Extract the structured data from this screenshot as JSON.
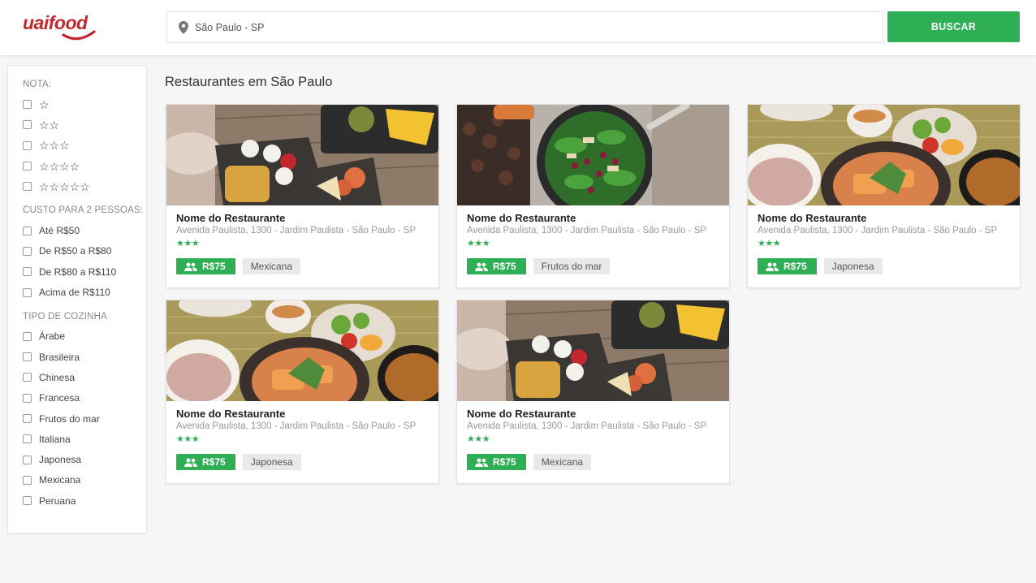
{
  "brand": {
    "name": "uaifood",
    "color": "#c1272d"
  },
  "search": {
    "value": "São Paulo - SP",
    "button_label": "BUSCAR"
  },
  "accent_color": "#2eaf55",
  "filters": {
    "rating": {
      "title": "NOTA:",
      "options": [
        "☆",
        "☆☆",
        "☆☆☆",
        "☆☆☆☆",
        "☆☆☆☆☆"
      ]
    },
    "cost": {
      "title": "CUSTO PARA 2 PESSOAS:",
      "options": [
        "Até R$50",
        "De R$50 a R$80",
        "De R$80 a R$110",
        "Acima de R$110"
      ]
    },
    "cuisine": {
      "title": "TIPO DE COZINHA",
      "options": [
        "Árabe",
        "Brasileira",
        "Chinesa",
        "Francesa",
        "Frutos do mar",
        "Italiana",
        "Japonesa",
        "Mexicana",
        "Peruana"
      ]
    }
  },
  "page_title": "Restaurantes em São Paulo",
  "restaurants": [
    {
      "name": "Nome do Restaurante",
      "address": "Avenida Paulista, 1300 - Jardim Paulista - São Paulo - SP",
      "rating_stars": "★★★",
      "price": "R$75",
      "cuisine": "Mexicana",
      "photo": "mexican-food-photo"
    },
    {
      "name": "Nome do Restaurante",
      "address": "Avenida Paulista, 1300 - Jardim Paulista - São Paulo - SP",
      "rating_stars": "★★★",
      "price": "R$75",
      "cuisine": "Frutos do mar",
      "photo": "salad-food-photo"
    },
    {
      "name": "Nome do Restaurante",
      "address": "Avenida Paulista, 1300 - Jardim Paulista - São Paulo - SP",
      "rating_stars": "★★★",
      "price": "R$75",
      "cuisine": "Japonesa",
      "photo": "japanese-food-photo"
    },
    {
      "name": "Nome do Restaurante",
      "address": "Avenida Paulista, 1300 - Jardim Paulista - São Paulo - SP",
      "rating_stars": "★★★",
      "price": "R$75",
      "cuisine": "Japonesa",
      "photo": "japanese-food-photo"
    },
    {
      "name": "Nome do Restaurante",
      "address": "Avenida Paulista, 1300 - Jardim Paulista - São Paulo - SP",
      "rating_stars": "★★★",
      "price": "R$75",
      "cuisine": "Mexicana",
      "photo": "mexican-food-photo"
    }
  ]
}
